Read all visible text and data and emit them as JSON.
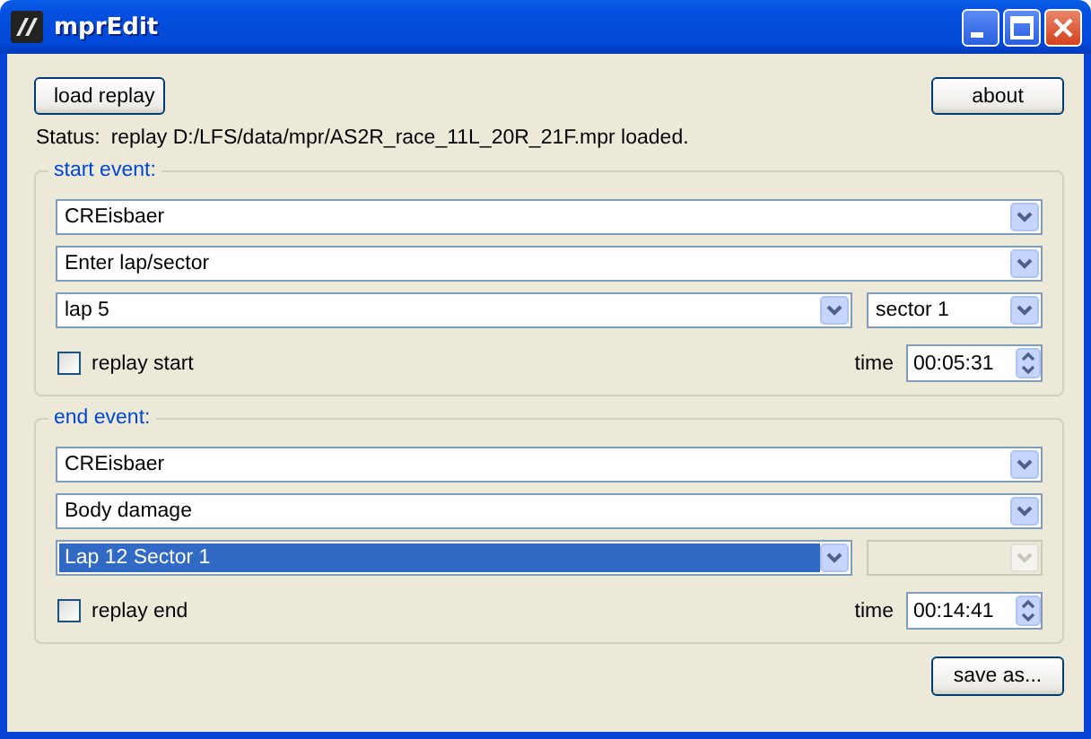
{
  "window": {
    "title": "mprEdit"
  },
  "toolbar": {
    "left_button": "load replay",
    "right_button": "about"
  },
  "status": {
    "label": "Status:",
    "text": "replay D:/LFS/data/mpr/AS2R_race_11L_20R_21F.mpr loaded."
  },
  "groups": [
    {
      "title": "start event:",
      "rows": [
        [
          {
            "value": "CREisbaer",
            "disabled": false,
            "focused": false
          }
        ],
        [
          {
            "value": "Enter lap/sector",
            "disabled": false,
            "focused": false
          }
        ],
        [
          {
            "value": "lap 5",
            "disabled": false,
            "focused": false
          },
          {
            "value": "sector 1",
            "disabled": false,
            "focused": false
          }
        ]
      ],
      "checkbox": {
        "label": "replay start",
        "checked": false
      },
      "time": {
        "label": "time",
        "value": "00:05:31"
      }
    },
    {
      "title": "end event:",
      "rows": [
        [
          {
            "value": "CREisbaer",
            "disabled": false,
            "focused": false
          }
        ],
        [
          {
            "value": "Body damage",
            "disabled": false,
            "focused": false
          }
        ],
        [
          {
            "value": "Lap 12 Sector 1",
            "disabled": false,
            "focused": true
          },
          {
            "disabled": true,
            "focused": false
          }
        ]
      ],
      "checkbox": {
        "label": "replay end",
        "checked": false
      },
      "time": {
        "label": "time",
        "value": "00:14:41"
      }
    }
  ],
  "footer": {
    "button": "save as..."
  }
}
